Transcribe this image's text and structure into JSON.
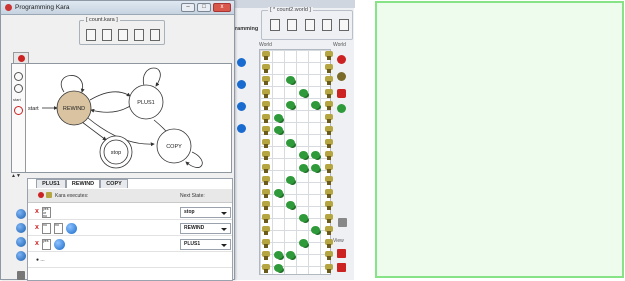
{
  "main_window": {
    "title": "Programming Kara",
    "toolbar_title": "[ count.kara ]",
    "window_buttons": [
      "–",
      "□",
      "x"
    ],
    "palette_labels": [
      "start",
      "stop"
    ]
  },
  "state_diagram": {
    "start_label": "start",
    "states": [
      {
        "name": "REWIND",
        "fill": "#d9c3a1"
      },
      {
        "name": "PLUS1",
        "fill": "#ffffff"
      },
      {
        "name": "COPY",
        "fill": "#ffffff"
      },
      {
        "name": "stop",
        "fill": "#ffffff"
      }
    ]
  },
  "splitter_label": "▲▼",
  "transition_table": {
    "tabs": [
      "PLUS1",
      "REWIND",
      "COPY"
    ],
    "active_tab": "REWIND",
    "header": {
      "kara_executes": "Kara executes:",
      "next_state": "Next State:"
    },
    "rows": [
      {
        "next_state": "stop",
        "cond": [
          "yes",
          "or",
          "no"
        ]
      },
      {
        "next_state": "REWIND",
        "cond": [
          "no",
          "no"
        ]
      },
      {
        "next_state": "PLUS1",
        "cond": [
          "yes"
        ]
      }
    ],
    "extra_row_label": "● ..."
  },
  "world_window": {
    "toolbar_title": "[ * count2.world ]",
    "tab_label": "ramming",
    "world_label": "World",
    "world2_label": "World",
    "view_label": "View"
  },
  "colors": {
    "accent_green": "#86e386",
    "state_highlight": "#d9c3a1",
    "tree_yellow": "#b6a642",
    "leaf_green": "#2f9a39"
  }
}
